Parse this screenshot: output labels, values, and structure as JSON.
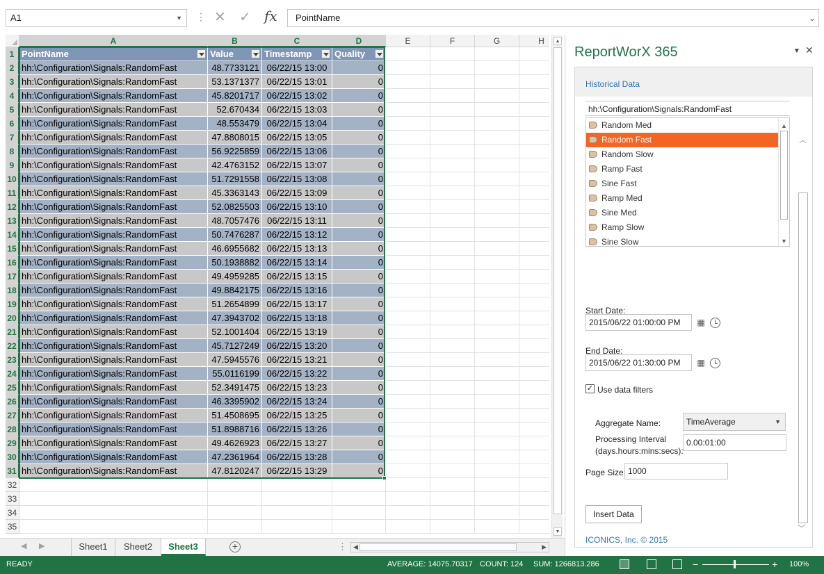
{
  "formula_bar": {
    "name_box": "A1",
    "formula": "PointName"
  },
  "columns": [
    "A",
    "B",
    "C",
    "D",
    "E",
    "F",
    "G",
    "H"
  ],
  "table": {
    "headers": [
      "PointName",
      "Value",
      "Timestamp",
      "Quality"
    ],
    "rows": [
      [
        "hh:\\Configuration\\Signals:RandomFast",
        "48.7733121",
        "06/22/15 13:00",
        "0"
      ],
      [
        "hh:\\Configuration\\Signals:RandomFast",
        "53.1371377",
        "06/22/15 13:01",
        "0"
      ],
      [
        "hh:\\Configuration\\Signals:RandomFast",
        "45.8201717",
        "06/22/15 13:02",
        "0"
      ],
      [
        "hh:\\Configuration\\Signals:RandomFast",
        "52.670434",
        "06/22/15 13:03",
        "0"
      ],
      [
        "hh:\\Configuration\\Signals:RandomFast",
        "48.553479",
        "06/22/15 13:04",
        "0"
      ],
      [
        "hh:\\Configuration\\Signals:RandomFast",
        "47.8808015",
        "06/22/15 13:05",
        "0"
      ],
      [
        "hh:\\Configuration\\Signals:RandomFast",
        "56.9225859",
        "06/22/15 13:06",
        "0"
      ],
      [
        "hh:\\Configuration\\Signals:RandomFast",
        "42.4763152",
        "06/22/15 13:07",
        "0"
      ],
      [
        "hh:\\Configuration\\Signals:RandomFast",
        "51.7291558",
        "06/22/15 13:08",
        "0"
      ],
      [
        "hh:\\Configuration\\Signals:RandomFast",
        "45.3363143",
        "06/22/15 13:09",
        "0"
      ],
      [
        "hh:\\Configuration\\Signals:RandomFast",
        "52.0825503",
        "06/22/15 13:10",
        "0"
      ],
      [
        "hh:\\Configuration\\Signals:RandomFast",
        "48.7057476",
        "06/22/15 13:11",
        "0"
      ],
      [
        "hh:\\Configuration\\Signals:RandomFast",
        "50.7476287",
        "06/22/15 13:12",
        "0"
      ],
      [
        "hh:\\Configuration\\Signals:RandomFast",
        "46.6955682",
        "06/22/15 13:13",
        "0"
      ],
      [
        "hh:\\Configuration\\Signals:RandomFast",
        "50.1938882",
        "06/22/15 13:14",
        "0"
      ],
      [
        "hh:\\Configuration\\Signals:RandomFast",
        "49.4959285",
        "06/22/15 13:15",
        "0"
      ],
      [
        "hh:\\Configuration\\Signals:RandomFast",
        "49.8842175",
        "06/22/15 13:16",
        "0"
      ],
      [
        "hh:\\Configuration\\Signals:RandomFast",
        "51.2654899",
        "06/22/15 13:17",
        "0"
      ],
      [
        "hh:\\Configuration\\Signals:RandomFast",
        "47.3943702",
        "06/22/15 13:18",
        "0"
      ],
      [
        "hh:\\Configuration\\Signals:RandomFast",
        "52.1001404",
        "06/22/15 13:19",
        "0"
      ],
      [
        "hh:\\Configuration\\Signals:RandomFast",
        "45.7127249",
        "06/22/15 13:20",
        "0"
      ],
      [
        "hh:\\Configuration\\Signals:RandomFast",
        "47.5945576",
        "06/22/15 13:21",
        "0"
      ],
      [
        "hh:\\Configuration\\Signals:RandomFast",
        "55.0116199",
        "06/22/15 13:22",
        "0"
      ],
      [
        "hh:\\Configuration\\Signals:RandomFast",
        "52.3491475",
        "06/22/15 13:23",
        "0"
      ],
      [
        "hh:\\Configuration\\Signals:RandomFast",
        "46.3395902",
        "06/22/15 13:24",
        "0"
      ],
      [
        "hh:\\Configuration\\Signals:RandomFast",
        "51.4508695",
        "06/22/15 13:25",
        "0"
      ],
      [
        "hh:\\Configuration\\Signals:RandomFast",
        "51.8988716",
        "06/22/15 13:26",
        "0"
      ],
      [
        "hh:\\Configuration\\Signals:RandomFast",
        "49.4626923",
        "06/22/15 13:27",
        "0"
      ],
      [
        "hh:\\Configuration\\Signals:RandomFast",
        "47.2361964",
        "06/22/15 13:28",
        "0"
      ],
      [
        "hh:\\Configuration\\Signals:RandomFast",
        "47.8120247",
        "06/22/15 13:29",
        "0"
      ]
    ],
    "empty_rows": [
      "32",
      "33",
      "34",
      "35"
    ]
  },
  "sheets": {
    "tabs": [
      "Sheet1",
      "Sheet2",
      "Sheet3"
    ],
    "active": "Sheet3"
  },
  "pane": {
    "title": "ReportWorX 365",
    "tab": "Historical Data",
    "tag_path": "hh:\\Configuration\\Signals:RandomFast",
    "tags": [
      "Random Med",
      "Random Fast",
      "Random Slow",
      "Ramp Fast",
      "Sine Fast",
      "Ramp Med",
      "Sine Med",
      "Ramp Slow",
      "Sine Slow"
    ],
    "selected_tag": "Random Fast",
    "start_date_label": "Start Date:",
    "start_date": "2015/06/22 01:00:00 PM",
    "end_date_label": "End Date:",
    "end_date": "2015/06/22 01:30:00 PM",
    "use_filters_label": "Use data filters",
    "use_filters_checked": true,
    "aggregate_label": "Aggregate Name:",
    "aggregate_value": "TimeAverage",
    "interval_label_1": "Processing Interval",
    "interval_label_2": "(days.hours:mins:secs):",
    "interval_value": "0.00:01:00",
    "page_size_label": "Page Size:",
    "page_size": "1000",
    "insert_button": "Insert Data",
    "footer": "ICONICS, Inc. © 2015"
  },
  "status_bar": {
    "mode": "READY",
    "average": "AVERAGE: 14075.70317",
    "count": "COUNT: 124",
    "sum": "SUM: 1266813.286",
    "zoom": "100%"
  },
  "colors": {
    "excel_green": "#217346",
    "table_header": "#7f96b7",
    "band_blue": "#a4b2c5",
    "band_gray": "#c8c8c8",
    "selected_tag": "#f26522",
    "pane_title": "#217346",
    "link": "#2e75b6"
  },
  "icons": {
    "cancel": "close-x-icon",
    "enter": "checkmark-icon",
    "function": "fx-icon",
    "calendar": "calendar-icon",
    "clock": "clock-icon",
    "tag": "tag-icon"
  }
}
